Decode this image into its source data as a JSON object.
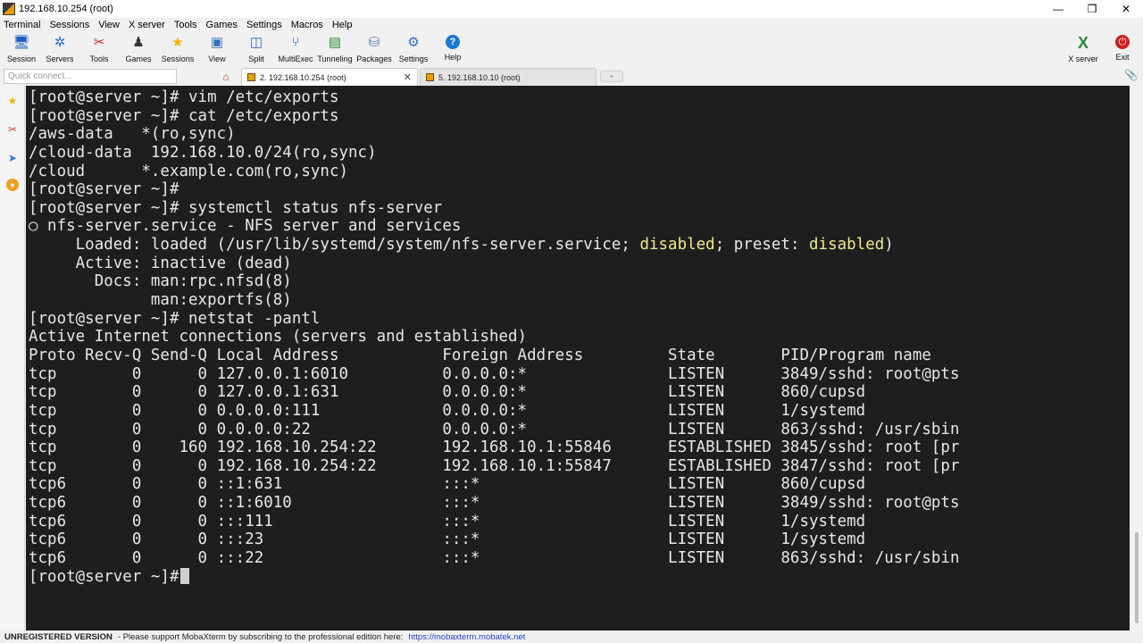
{
  "window": {
    "title": "192.168.10.254 (root)",
    "controls": {
      "minimize": "—",
      "restore": "❐",
      "close": "✕"
    }
  },
  "menu": [
    "Terminal",
    "Sessions",
    "View",
    "X server",
    "Tools",
    "Games",
    "Settings",
    "Macros",
    "Help"
  ],
  "toolbar": {
    "items": [
      {
        "label": "Session",
        "icon": "session-icon",
        "glyph": "🖥",
        "color": "#1f5fbf"
      },
      {
        "label": "Servers",
        "icon": "servers-icon",
        "glyph": "✲",
        "color": "#1f6fd0"
      },
      {
        "label": "Tools",
        "icon": "tools-icon",
        "glyph": "✂",
        "color": "#c03020"
      },
      {
        "label": "Games",
        "icon": "games-icon",
        "glyph": "♟",
        "color": "#333333"
      },
      {
        "label": "Sessions",
        "icon": "star-icon",
        "glyph": "★",
        "color": "#f0b400"
      },
      {
        "label": "View",
        "icon": "view-icon",
        "glyph": "▣",
        "color": "#3a70c0"
      },
      {
        "label": "Split",
        "icon": "split-icon",
        "glyph": "◫",
        "color": "#2d6cc0"
      },
      {
        "label": "MultiExec",
        "icon": "multiexec-icon",
        "glyph": "⑂",
        "color": "#2050a0"
      },
      {
        "label": "Tunneling",
        "icon": "tunneling-icon",
        "glyph": "▤",
        "color": "#2a8a3a"
      },
      {
        "label": "Packages",
        "icon": "packages-icon",
        "glyph": "⛁",
        "color": "#5a7ab0"
      },
      {
        "label": "Settings",
        "icon": "settings-icon",
        "glyph": "⚙",
        "color": "#2a70c8"
      },
      {
        "label": "Help",
        "icon": "help-icon",
        "glyph": "?",
        "color": "#1a78d8"
      }
    ],
    "right": [
      {
        "label": "X server",
        "icon": "x-server-icon",
        "glyph": "X",
        "color": "#2a8a3a"
      },
      {
        "label": "Exit",
        "icon": "exit-icon",
        "glyph": "⏻",
        "color": "#d02020"
      }
    ]
  },
  "quick_connect": {
    "placeholder": "Quick connect..."
  },
  "tabs": [
    {
      "label": "2. 192.168.10.254 (root)",
      "active": true,
      "close": "✕"
    },
    {
      "label": "5. 192.168.10.10 (root)",
      "active": false
    }
  ],
  "sidebar": {
    "icons": [
      "star-icon",
      "tools-icon",
      "send-icon",
      "macro-icon"
    ]
  },
  "terminal": {
    "lines": [
      "[root@server ~]# vim /etc/exports",
      "[root@server ~]# cat /etc/exports",
      "/aws-data   *(ro,sync)",
      "/cloud-data  192.168.10.0/24(ro,sync)",
      "/cloud      *.example.com(ro,sync)",
      "[root@server ~]#",
      "[root@server ~]# systemctl status nfs-server",
      "○ nfs-server.service - NFS server and services",
      {
        "segments": [
          {
            "text": "     Loaded: loaded (/usr/lib/systemd/system/nfs-server.service; "
          },
          {
            "text": "disabled",
            "hl": true
          },
          {
            "text": "; preset: "
          },
          {
            "text": "disabled",
            "hl": true
          },
          {
            "text": ")"
          }
        ]
      },
      "     Active: inactive (dead)",
      "       Docs: man:rpc.nfsd(8)",
      "             man:exportfs(8)",
      "[root@server ~]# netstat -pantl",
      "Active Internet connections (servers and established)",
      "Proto Recv-Q Send-Q Local Address           Foreign Address         State       PID/Program name",
      "tcp        0      0 127.0.0.1:6010          0.0.0.0:*               LISTEN      3849/sshd: root@pts",
      "tcp        0      0 127.0.0.1:631           0.0.0.0:*               LISTEN      860/cupsd",
      "tcp        0      0 0.0.0.0:111             0.0.0.0:*               LISTEN      1/systemd",
      "tcp        0      0 0.0.0.0:22              0.0.0.0:*               LISTEN      863/sshd: /usr/sbin",
      "tcp        0    160 192.168.10.254:22       192.168.10.1:55846      ESTABLISHED 3845/sshd: root [pr",
      "tcp        0      0 192.168.10.254:22       192.168.10.1:55847      ESTABLISHED 3847/sshd: root [pr",
      "tcp6       0      0 ::1:631                 :::*                    LISTEN      860/cupsd",
      "tcp6       0      0 ::1:6010                :::*                    LISTEN      3849/sshd: root@pts",
      "tcp6       0      0 :::111                  :::*                    LISTEN      1/systemd",
      "tcp6       0      0 :::23                   :::*                    LISTEN      1/systemd",
      "tcp6       0      0 :::22                   :::*                    LISTEN      863/sshd: /usr/sbin"
    ],
    "prompt": "[root@server ~]# ",
    "colors": {
      "background": "#1e1e1e",
      "foreground": "#e8e8e8",
      "highlight": "#ecec8c"
    }
  },
  "status": {
    "unregistered": "UNREGISTERED VERSION",
    "message": "-  Please support MobaXterm by subscribing to the professional edition here:",
    "link": "https://mobaxterm.mobatek.net"
  }
}
